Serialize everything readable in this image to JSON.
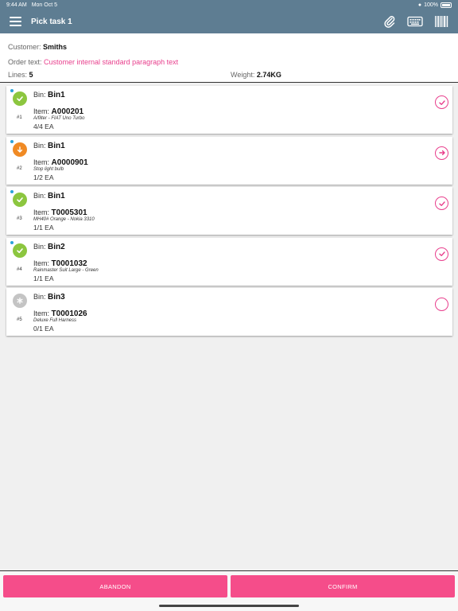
{
  "status_bar": {
    "time": "9:44 AM",
    "date": "Mon Oct 5",
    "battery": "100%"
  },
  "nav": {
    "title": "Pick task 1"
  },
  "header": {
    "customer_label": "Customer:",
    "customer_value": "Smiths",
    "order_text_label": "Order text:",
    "order_text_value": "Customer internal standard paragraph text",
    "lines_label": "Lines:",
    "lines_value": "5",
    "weight_label": "Weight:",
    "weight_value": "2.74KG"
  },
  "lines": [
    {
      "no": "#1",
      "bin_label": "Bin:",
      "bin": "Bin1",
      "item_label": "Item:",
      "item": "A000201",
      "desc": "A/filter - FIAT Uno Turbo",
      "qty": "4/4 EA",
      "status": "done",
      "status_color": "#8cc63f",
      "action": "check-circle-icon"
    },
    {
      "no": "#2",
      "bin_label": "Bin:",
      "bin": "Bin1",
      "item_label": "Item:",
      "item": "A0000901",
      "desc": "Stop light bulb",
      "qty": "1/2 EA",
      "status": "partial",
      "status_color": "#f08a24",
      "action": "arrow-right-circle-icon"
    },
    {
      "no": "#3",
      "bin_label": "Bin:",
      "bin": "Bin1",
      "item_label": "Item:",
      "item": "T0005301",
      "desc": "MH40# Orange - Nokia 3310",
      "qty": "1/1 EA",
      "status": "done",
      "status_color": "#8cc63f",
      "action": "check-circle-icon"
    },
    {
      "no": "#4",
      "bin_label": "Bin:",
      "bin": "Bin2",
      "item_label": "Item:",
      "item": "T0001032",
      "desc": "Rainmaster Suit Large - Green",
      "qty": "1/1 EA",
      "status": "done",
      "status_color": "#8cc63f",
      "action": "check-circle-icon"
    },
    {
      "no": "#5",
      "bin_label": "Bin:",
      "bin": "Bin3",
      "item_label": "Item:",
      "item": "T0001026",
      "desc": "Deluxe Full Harness",
      "qty": "0/1 EA",
      "status": "pending",
      "status_color": "#c4c4c4",
      "action": "empty-circle-icon"
    }
  ],
  "footer": {
    "abandon_label": "ABANDON",
    "confirm_label": "CONFIRM"
  },
  "colors": {
    "nav_bg": "#5e7d92",
    "accent": "#e83e8c",
    "button": "#f54d8a",
    "unread_dot": "#2aa3d9"
  }
}
